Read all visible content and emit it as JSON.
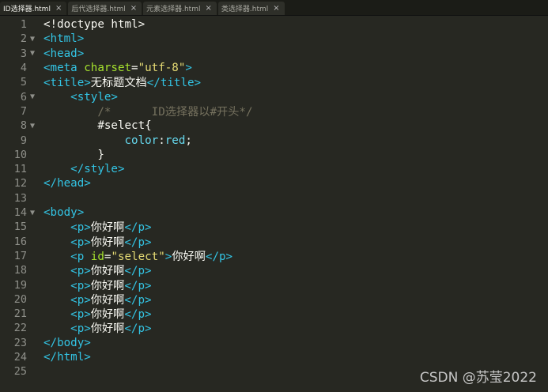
{
  "tabs": [
    {
      "label": "ID选择器.html",
      "close": "×"
    },
    {
      "label": "后代选择器.html",
      "close": "×"
    },
    {
      "label": "元素选择器.html",
      "close": "×"
    },
    {
      "label": "类选择器.html",
      "close": "×"
    }
  ],
  "fold_glyph": "▼",
  "lines": [
    {
      "n": "1",
      "segs": [
        "<!doctype html>"
      ]
    },
    {
      "n": "2",
      "segs": [
        "<html>"
      ]
    },
    {
      "n": "3",
      "segs": [
        "<head>"
      ]
    },
    {
      "n": "4",
      "segs": [
        "<meta ",
        "charset",
        "=",
        "\"utf-8\"",
        ">"
      ]
    },
    {
      "n": "5",
      "segs": [
        "<title>",
        "无标题文档",
        "</title>"
      ]
    },
    {
      "n": "6",
      "segs": [
        "    ",
        "<style>"
      ]
    },
    {
      "n": "7",
      "segs": [
        "        ",
        "/*      ID选择器以#开头*/"
      ]
    },
    {
      "n": "8",
      "segs": [
        "        ",
        "#select{"
      ]
    },
    {
      "n": "9",
      "segs": [
        "            ",
        "color",
        ":",
        "red",
        ";"
      ]
    },
    {
      "n": "10",
      "segs": [
        "        ",
        "}"
      ]
    },
    {
      "n": "11",
      "segs": [
        "    ",
        "</style>"
      ]
    },
    {
      "n": "12",
      "segs": [
        "</head>"
      ]
    },
    {
      "n": "13",
      "segs": []
    },
    {
      "n": "14",
      "segs": [
        "<body>"
      ]
    },
    {
      "n": "15",
      "segs": [
        "    ",
        "<p>",
        "你好啊",
        "</p>"
      ]
    },
    {
      "n": "16",
      "segs": [
        "    ",
        "<p>",
        "你好啊",
        "</p>"
      ]
    },
    {
      "n": "17",
      "segs": [
        "    ",
        "<p ",
        "id",
        "=",
        "\"select\"",
        ">",
        "你好啊",
        "</p>"
      ]
    },
    {
      "n": "18",
      "segs": [
        "    ",
        "<p>",
        "你好啊",
        "</p>"
      ]
    },
    {
      "n": "19",
      "segs": [
        "    ",
        "<p>",
        "你好啊",
        "</p>"
      ]
    },
    {
      "n": "20",
      "segs": [
        "    ",
        "<p>",
        "你好啊",
        "</p>"
      ]
    },
    {
      "n": "21",
      "segs": [
        "    ",
        "<p>",
        "你好啊",
        "</p>"
      ]
    },
    {
      "n": "22",
      "segs": [
        "    ",
        "<p>",
        "你好啊",
        "</p>"
      ]
    },
    {
      "n": "23",
      "segs": [
        "</body>"
      ]
    },
    {
      "n": "24",
      "segs": [
        "</html>"
      ]
    },
    {
      "n": "25",
      "segs": []
    }
  ],
  "watermark": "CSDN @苏莹2022",
  "colors": {
    "background": "#272822",
    "tag": "#33c4e4",
    "attribute": "#a6e22e",
    "string": "#e6db74",
    "comment": "#75715e",
    "text": "#f8f8f2"
  }
}
